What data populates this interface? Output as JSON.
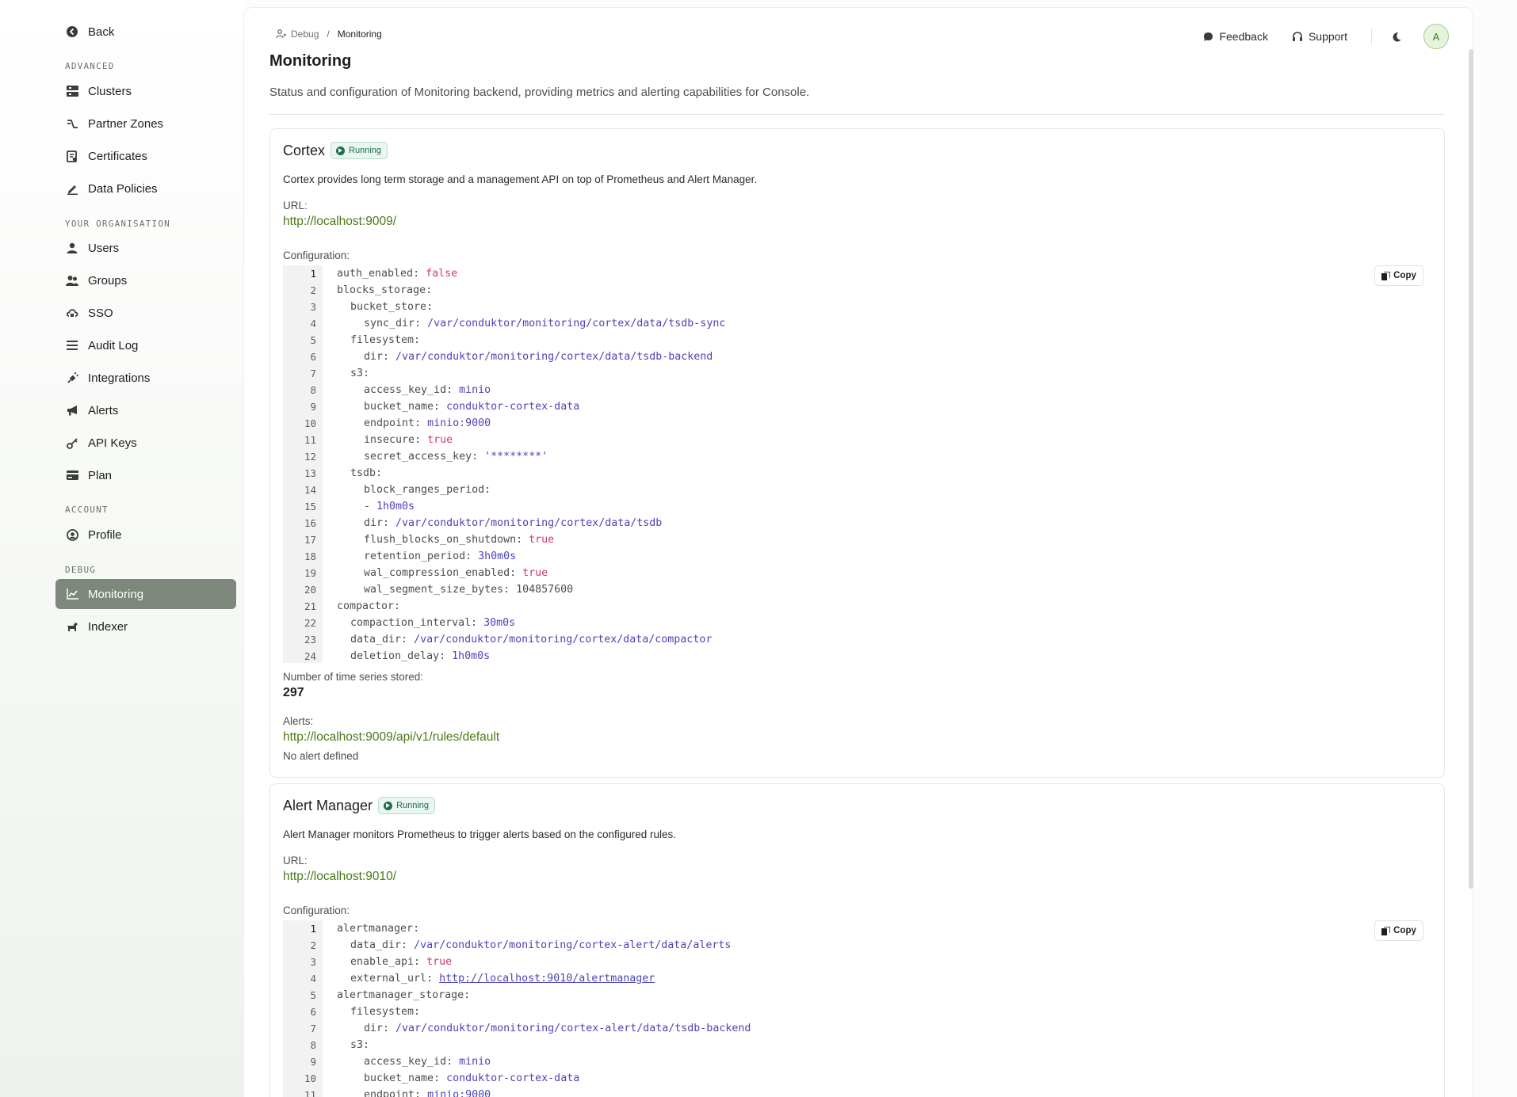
{
  "sidebar": {
    "back": "Back",
    "sections": {
      "advanced": "ADVANCED",
      "organisation": "YOUR ORGANISATION",
      "account": "ACCOUNT",
      "debug": "DEBUG"
    },
    "advanced": [
      "Clusters",
      "Partner Zones",
      "Certificates",
      "Data Policies"
    ],
    "organisation": [
      "Users",
      "Groups",
      "SSO",
      "Audit Log",
      "Integrations",
      "Alerts",
      "API Keys",
      "Plan"
    ],
    "account": [
      "Profile"
    ],
    "debug": [
      "Monitoring",
      "Indexer"
    ],
    "active": "Monitoring"
  },
  "topbar": {
    "breadcrumb_root": "Debug",
    "breadcrumb_current": "Monitoring",
    "feedback": "Feedback",
    "support": "Support",
    "avatar": "A"
  },
  "page": {
    "title": "Monitoring",
    "description": "Status and configuration of Monitoring backend, providing metrics and alerting capabilities for Console."
  },
  "labels": {
    "url": "URL:",
    "configuration": "Configuration:",
    "series": "Number of time series stored:",
    "alerts": "Alerts:",
    "copy": "Copy",
    "running": "Running"
  },
  "cortex": {
    "title": "Cortex",
    "status": "Running",
    "description": "Cortex provides long term storage and a management API on top of Prometheus and Alert Manager.",
    "url": "http://localhost:9009/",
    "series_count": "297",
    "alerts_url": "http://localhost:9009/api/v1/rules/default",
    "alerts_empty": "No alert defined",
    "config": [
      {
        "n": "1",
        "indent": 0,
        "key": "auth_enabled:",
        "val": "false",
        "type": "bool"
      },
      {
        "n": "2",
        "indent": 0,
        "key": "blocks_storage:",
        "val": "",
        "type": ""
      },
      {
        "n": "3",
        "indent": 1,
        "key": "bucket_store:",
        "val": "",
        "type": ""
      },
      {
        "n": "4",
        "indent": 2,
        "key": "sync_dir:",
        "val": "/var/conduktor/monitoring/cortex/data/tsdb-sync",
        "type": "str"
      },
      {
        "n": "5",
        "indent": 1,
        "key": "filesystem:",
        "val": "",
        "type": ""
      },
      {
        "n": "6",
        "indent": 2,
        "key": "dir:",
        "val": "/var/conduktor/monitoring/cortex/data/tsdb-backend",
        "type": "str"
      },
      {
        "n": "7",
        "indent": 1,
        "key": "s3:",
        "val": "",
        "type": ""
      },
      {
        "n": "8",
        "indent": 2,
        "key": "access_key_id:",
        "val": "minio",
        "type": "str"
      },
      {
        "n": "9",
        "indent": 2,
        "key": "bucket_name:",
        "val": "conduktor-cortex-data",
        "type": "str"
      },
      {
        "n": "10",
        "indent": 2,
        "key": "endpoint:",
        "val": "minio:9000",
        "type": "str"
      },
      {
        "n": "11",
        "indent": 2,
        "key": "insecure:",
        "val": "true",
        "type": "bool"
      },
      {
        "n": "12",
        "indent": 2,
        "key": "secret_access_key:",
        "val": "'********'",
        "type": "str"
      },
      {
        "n": "13",
        "indent": 1,
        "key": "tsdb:",
        "val": "",
        "type": ""
      },
      {
        "n": "14",
        "indent": 2,
        "key": "block_ranges_period:",
        "val": "",
        "type": ""
      },
      {
        "n": "15",
        "indent": 2,
        "key": "-",
        "val": "1h0m0s",
        "type": "str"
      },
      {
        "n": "16",
        "indent": 2,
        "key": "dir:",
        "val": "/var/conduktor/monitoring/cortex/data/tsdb",
        "type": "str"
      },
      {
        "n": "17",
        "indent": 2,
        "key": "flush_blocks_on_shutdown:",
        "val": "true",
        "type": "bool"
      },
      {
        "n": "18",
        "indent": 2,
        "key": "retention_period:",
        "val": "3h0m0s",
        "type": "str"
      },
      {
        "n": "19",
        "indent": 2,
        "key": "wal_compression_enabled:",
        "val": "true",
        "type": "bool"
      },
      {
        "n": "20",
        "indent": 2,
        "key": "wal_segment_size_bytes:",
        "val": "104857600",
        "type": "num"
      },
      {
        "n": "21",
        "indent": 0,
        "key": "compactor:",
        "val": "",
        "type": ""
      },
      {
        "n": "22",
        "indent": 1,
        "key": "compaction_interval:",
        "val": "30m0s",
        "type": "str"
      },
      {
        "n": "23",
        "indent": 1,
        "key": "data_dir:",
        "val": "/var/conduktor/monitoring/cortex/data/compactor",
        "type": "str"
      },
      {
        "n": "24",
        "indent": 1,
        "key": "deletion_delay:",
        "val": "1h0m0s",
        "type": "str"
      }
    ]
  },
  "alertmanager": {
    "title": "Alert Manager",
    "status": "Running",
    "description": "Alert Manager monitors Prometheus to trigger alerts based on the configured rules.",
    "url": "http://localhost:9010/",
    "config": [
      {
        "n": "1",
        "indent": 0,
        "key": "alertmanager:",
        "val": "",
        "type": ""
      },
      {
        "n": "2",
        "indent": 1,
        "key": "data_dir:",
        "val": "/var/conduktor/monitoring/cortex-alert/data/alerts",
        "type": "str"
      },
      {
        "n": "3",
        "indent": 1,
        "key": "enable_api:",
        "val": "true",
        "type": "bool"
      },
      {
        "n": "4",
        "indent": 1,
        "key": "external_url:",
        "val": "http://localhost:9010/alertmanager",
        "type": "url"
      },
      {
        "n": "5",
        "indent": 0,
        "key": "alertmanager_storage:",
        "val": "",
        "type": ""
      },
      {
        "n": "6",
        "indent": 1,
        "key": "filesystem:",
        "val": "",
        "type": ""
      },
      {
        "n": "7",
        "indent": 2,
        "key": "dir:",
        "val": "/var/conduktor/monitoring/cortex-alert/data/tsdb-backend",
        "type": "str"
      },
      {
        "n": "8",
        "indent": 1,
        "key": "s3:",
        "val": "",
        "type": ""
      },
      {
        "n": "9",
        "indent": 2,
        "key": "access_key_id:",
        "val": "minio",
        "type": "str"
      },
      {
        "n": "10",
        "indent": 2,
        "key": "bucket_name:",
        "val": "conduktor-cortex-data",
        "type": "str"
      },
      {
        "n": "11",
        "indent": 2,
        "key": "endpoint:",
        "val": "minio:9000",
        "type": "str"
      }
    ]
  },
  "colors": {
    "accent_link": "#4a7a16",
    "active_nav": "#7e877c",
    "running": "#1f6b4e",
    "code_string": "#4d44b5",
    "code_bool": "#d0376b"
  },
  "icons": {
    "back": "arrow-left-circle-icon",
    "clusters": "server-icon",
    "partner_zones": "route-icon",
    "certificates": "certificate-icon",
    "data_policies": "pen-icon",
    "users": "user-icon",
    "groups": "users-icon",
    "sso": "cloud-lock-icon",
    "audit_log": "list-icon",
    "integrations": "plug-icon",
    "alerts": "megaphone-icon",
    "api_keys": "key-icon",
    "plan": "credit-card-icon",
    "profile": "user-circle-icon",
    "monitoring": "chart-line-icon",
    "indexer": "dog-icon"
  }
}
